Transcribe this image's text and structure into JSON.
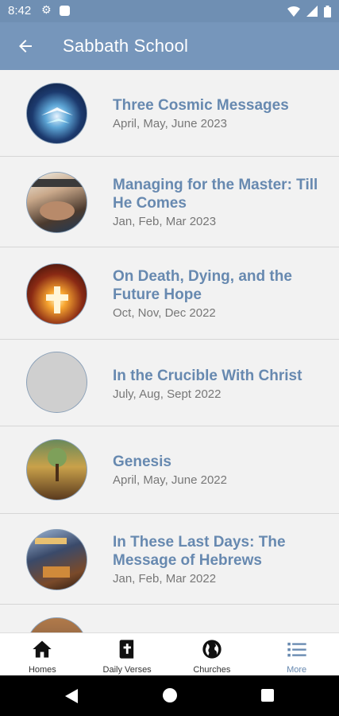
{
  "status_bar": {
    "time": "8:42"
  },
  "app_bar": {
    "title": "Sabbath School"
  },
  "lessons": [
    {
      "title": "Three Cosmic Messages",
      "period": "April, May, June 2023"
    },
    {
      "title": "Managing for the Master: Till He Comes",
      "period": "Jan, Feb, Mar 2023"
    },
    {
      "title": "On Death, Dying, and the Future Hope",
      "period": "Oct, Nov, Dec 2022"
    },
    {
      "title": "In the Crucible With Christ",
      "period": "July, Aug, Sept 2022"
    },
    {
      "title": "Genesis",
      "period": "April, May, June 2022"
    },
    {
      "title": "In These Last Days: The Message of Hebrews",
      "period": "Jan, Feb, Mar 2022"
    }
  ],
  "bottom_nav": [
    {
      "label": "Homes",
      "icon": "home-icon"
    },
    {
      "label": "Daily Verses",
      "icon": "bible-icon"
    },
    {
      "label": "Churches",
      "icon": "globe-icon"
    },
    {
      "label": "More",
      "icon": "list-icon"
    }
  ],
  "colors": {
    "app_bar": "#7696bb",
    "accent": "#6789b0"
  }
}
